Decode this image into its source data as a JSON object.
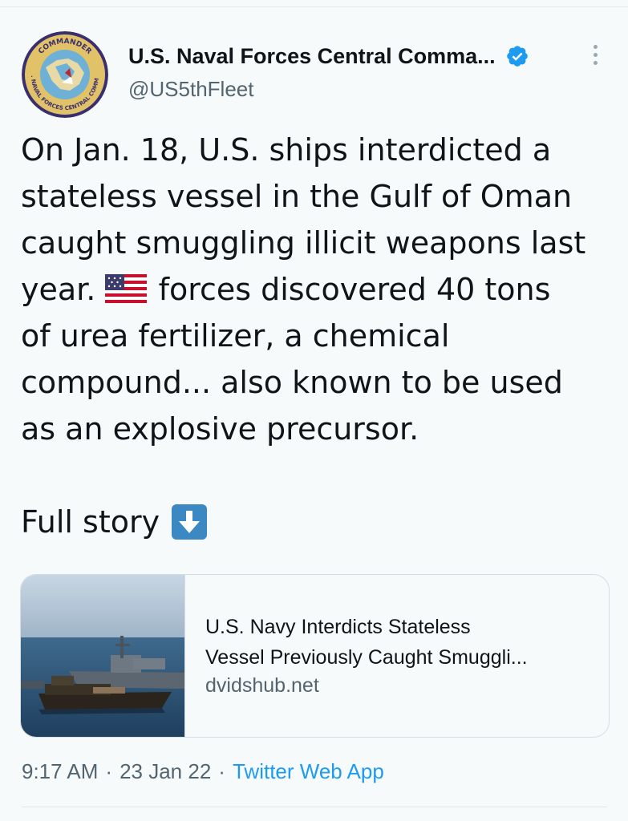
{
  "tweet": {
    "display_name": "U.S. Naval Forces Central Comma...",
    "handle": "@US5thFleet",
    "avatar": {
      "top_text": "COMMANDER",
      "bottom_text": "U.S. NAVAL FORCES CENTRAL COMMAND"
    },
    "verified_icon": "verified-badge-icon",
    "more_icon": "more-options-icon",
    "body_lines": [
      "On Jan. 18, U.S. ships interdicted a",
      "stateless vessel in the Gulf of Oman",
      "caught smuggling illicit weapons last",
      "forces discovered 40 tons",
      "of urea fertilizer, a chemical",
      "compound... also known to be used",
      "as an explosive precursor."
    ],
    "year_word": "year.",
    "flag_icon": "us-flag-emoji",
    "full_story": "Full story",
    "down_arrow_icon": "down-arrow-emoji",
    "card": {
      "title_line1": "U.S. Navy Interdicts Stateless",
      "title_line2": "Vessel Previously Caught Smuggli...",
      "domain": "dvidshub.net"
    },
    "meta": {
      "time": "9:17 AM",
      "separator": "·",
      "date": "23 Jan 22",
      "source": "Twitter Web App"
    }
  },
  "colors": {
    "background": "#f7fafa",
    "text": "#0f1419",
    "secondary": "#536471",
    "link": "#1d9bf0",
    "verified": "#1d9bf0"
  }
}
